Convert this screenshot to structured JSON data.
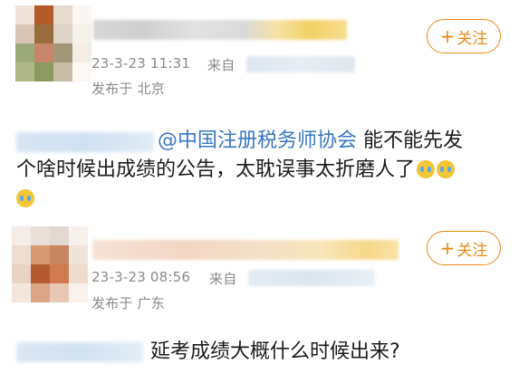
{
  "posts": [
    {
      "timestamp": "23-3-23 11:31",
      "source_prefix": "来自",
      "location": "发布于 北京",
      "follow_label": "关注",
      "mention": "@中国注册税务师协会",
      "content_line1_rest": " 能不能先发",
      "content_line2": "个啥时候出成绩的公告，太耽误事太折磨人了",
      "emoji_names": [
        "crying-face-emoji",
        "crying-face-emoji",
        "crying-face-emoji"
      ]
    },
    {
      "timestamp": "23-3-23 08:56",
      "source_prefix": "来自",
      "location": "发布于 广东",
      "follow_label": "关注",
      "content": "延考成绩大概什么时候出来?"
    }
  ],
  "colors": {
    "accent": "#e8891a",
    "link": "#3a77c2",
    "meta": "#8a8a8a"
  }
}
